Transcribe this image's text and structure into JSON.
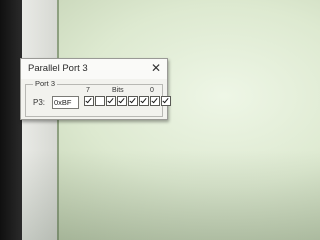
{
  "dialog": {
    "title": "Parallel Port 3",
    "close_glyph": "✕",
    "group_label": "Port 3",
    "port_label": "P3:",
    "port_value": "0xBF",
    "bit_high_label": "7",
    "bits_caption": "Bits",
    "bit_low_label": "0",
    "bits": [
      true,
      false,
      true,
      true,
      true,
      true,
      true,
      true
    ]
  },
  "icons": {
    "close": "close-icon",
    "check": "check-icon"
  }
}
